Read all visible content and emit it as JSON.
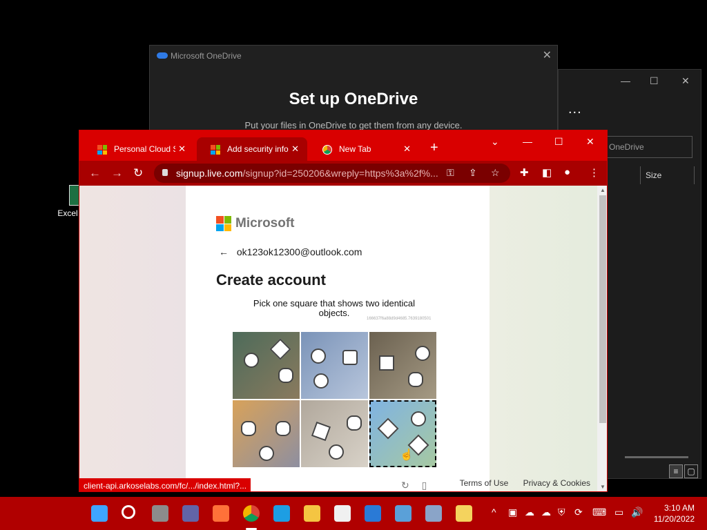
{
  "desktop": {
    "icon_label": "Excel"
  },
  "explorer": {
    "minimize": "—",
    "maximize": "☐",
    "close": "✕",
    "more": "...",
    "search_placeholder": "OneDrive",
    "col_size": "Size"
  },
  "onedrive": {
    "title": "Microsoft OneDrive",
    "close": "✕",
    "heading": "Set up OneDrive",
    "subtitle": "Put your files in OneDrive to get them from any device."
  },
  "chrome": {
    "tabs": [
      {
        "label": "Personal Cloud Sto",
        "close": "✕",
        "favicon": "microsoft-logo"
      },
      {
        "label": "Add security info",
        "close": "✕",
        "favicon": "microsoft-logo"
      },
      {
        "label": "New Tab",
        "close": "✕",
        "favicon": "chrome-logo"
      }
    ],
    "new_tab": "+",
    "tab_search": "⌄",
    "minimize": "—",
    "maximize": "☐",
    "close": "✕",
    "url_host": "signup.live.com",
    "url_rest": "/signup?id=250206&wreply=https%3a%2f%...",
    "status_url": "client-api.arkoselabs.com/fc/.../index.html?..."
  },
  "page": {
    "brand": "Microsoft",
    "back_arrow": "←",
    "email": "ok123ok12300@outlook.com",
    "heading": "Create account",
    "prompt": "Pick one square that shows two identical objects.",
    "challenge_id": "166637f6a88d9d4685.7639180501",
    "footer_terms": "Terms of Use",
    "footer_privacy": "Privacy & Cookies",
    "tiles": [
      {
        "bg": "#4d6b5a",
        "bg2": "#8a7a5e",
        "selected": false
      },
      {
        "bg": "#7a93b8",
        "bg2": "#b8c6dc",
        "selected": false
      },
      {
        "bg": "#6b6150",
        "bg2": "#a59a84",
        "selected": false
      },
      {
        "bg": "#d8a25a",
        "bg2": "#8e8fa0",
        "selected": false
      },
      {
        "bg": "#b1a89c",
        "bg2": "#d8d2c8",
        "selected": false
      },
      {
        "bg": "#7fb3e3",
        "bg2": "#a7c9a1",
        "selected": true
      }
    ]
  },
  "taskbar": {
    "time": "3:10 AM",
    "date": "11/20/2022",
    "icons": [
      {
        "name": "start",
        "color": "#3fa5ff"
      },
      {
        "name": "search",
        "color": "transparent"
      },
      {
        "name": "task-view",
        "color": "#8c8c8c"
      },
      {
        "name": "teams",
        "color": "#6264a7"
      },
      {
        "name": "firefox",
        "color": "#ff7139"
      },
      {
        "name": "chrome",
        "color": "#4285f4"
      },
      {
        "name": "edge",
        "color": "#1d9ee3"
      },
      {
        "name": "file-explorer",
        "color": "#f4c542"
      },
      {
        "name": "store",
        "color": "#f0f0f0"
      },
      {
        "name": "mail",
        "color": "#2a7ad6"
      },
      {
        "name": "remote-desktop",
        "color": "#5aa0d8"
      },
      {
        "name": "settings",
        "color": "#8aa4c8"
      },
      {
        "name": "notepad",
        "color": "#f4d35e"
      }
    ]
  }
}
